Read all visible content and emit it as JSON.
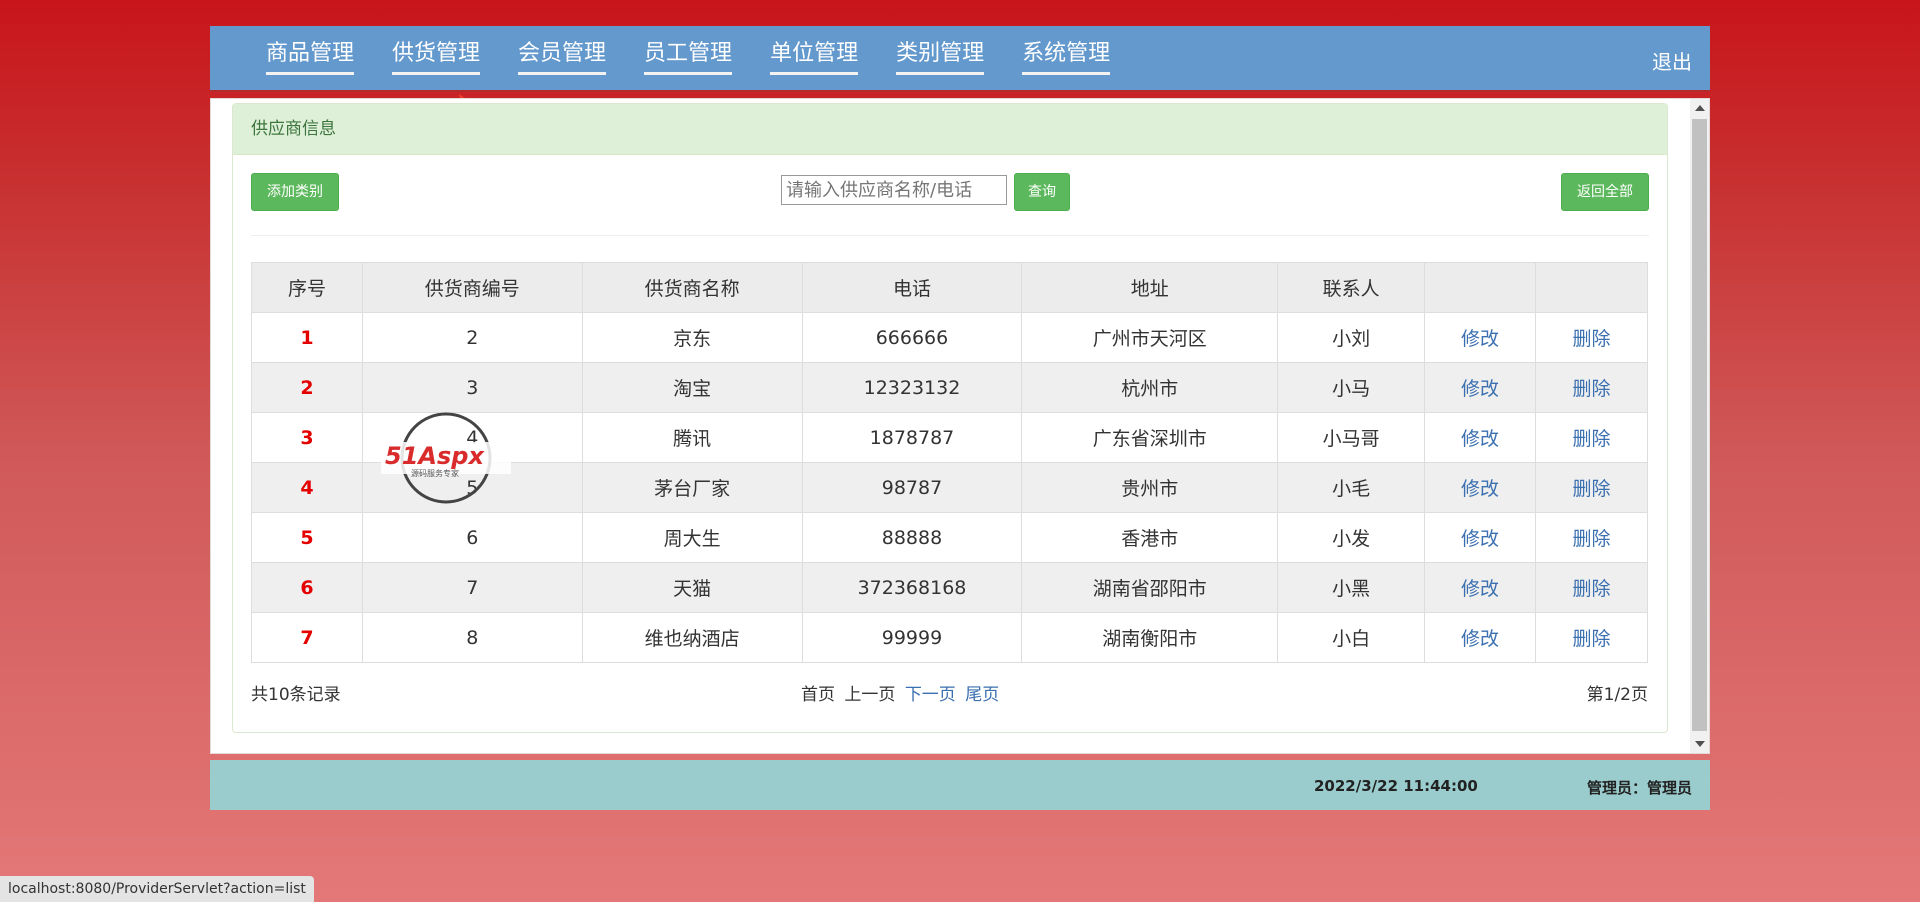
{
  "nav": {
    "items": [
      "商品管理",
      "供货管理",
      "会员管理",
      "员工管理",
      "单位管理",
      "类别管理",
      "系统管理"
    ],
    "logout": "退出"
  },
  "panel": {
    "title": "供应商信息",
    "add_label": "添加类别",
    "search_placeholder": "请输入供应商名称/电话",
    "query_label": "查询",
    "back_label": "返回全部"
  },
  "table": {
    "headers": [
      "序号",
      "供货商编号",
      "供货商名称",
      "电话",
      "地址",
      "联系人",
      "",
      ""
    ],
    "rows": [
      {
        "idx": "1",
        "code": "2",
        "name": "京东",
        "phone": "666666",
        "address": "广州市天河区",
        "contact": "小刘",
        "edit": "修改",
        "delete": "删除"
      },
      {
        "idx": "2",
        "code": "3",
        "name": "淘宝",
        "phone": "12323132",
        "address": "杭州市",
        "contact": "小马",
        "edit": "修改",
        "delete": "删除"
      },
      {
        "idx": "3",
        "code": "4",
        "name": "腾讯",
        "phone": "1878787",
        "address": "广东省深圳市",
        "contact": "小马哥",
        "edit": "修改",
        "delete": "删除"
      },
      {
        "idx": "4",
        "code": "5",
        "name": "茅台厂家",
        "phone": "98787",
        "address": "贵州市",
        "contact": "小毛",
        "edit": "修改",
        "delete": "删除"
      },
      {
        "idx": "5",
        "code": "6",
        "name": "周大生",
        "phone": "88888",
        "address": "香港市",
        "contact": "小发",
        "edit": "修改",
        "delete": "删除"
      },
      {
        "idx": "6",
        "code": "7",
        "name": "天猫",
        "phone": "372368168",
        "address": "湖南省邵阳市",
        "contact": "小黑",
        "edit": "修改",
        "delete": "删除"
      },
      {
        "idx": "7",
        "code": "8",
        "name": "维也纳酒店",
        "phone": "99999",
        "address": "湖南衡阳市",
        "contact": "小白",
        "edit": "修改",
        "delete": "删除"
      }
    ]
  },
  "pager": {
    "total": "共10条记录",
    "first": "首页",
    "prev": "上一页",
    "next": "下一页",
    "last": "尾页",
    "page_info": "第1/2页"
  },
  "watermark": {
    "brand": "51Aspx",
    "tagline": "源码服务专家"
  },
  "footer": {
    "time": "2022/3/22 11:44:00",
    "admin": "管理员：管理员"
  },
  "statusbar": "localhost:8080/ProviderServlet?action=list",
  "colors": {
    "nav_bg": "#6499cd",
    "button_green": "#5cb85c",
    "panel_head": "#dff0d8",
    "index_red": "#e50000",
    "link_blue": "#3a6fb0",
    "footer_bg": "#9acccd"
  }
}
